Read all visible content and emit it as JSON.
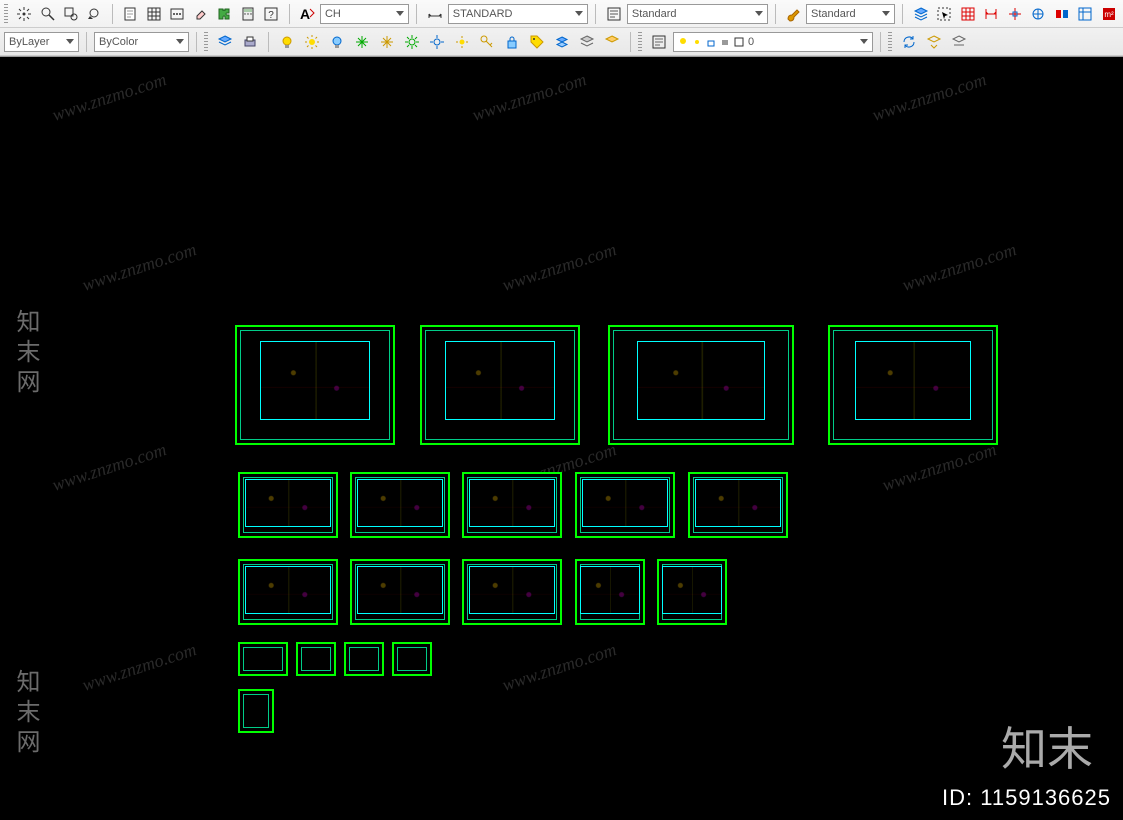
{
  "toolbar": {
    "font_style": "CH",
    "text_style": "STANDARD",
    "dim_style": "Standard",
    "table_style": "Standard",
    "line_weight": "ByLayer",
    "color_value": "ByColor",
    "layer_state": "0",
    "lock_indicator": "0"
  },
  "watermark_text": "www.znzmo.com",
  "watermark_brand": "知末",
  "side_brand": "知末网",
  "id_label": "ID: 1159136625",
  "sheets_row1": [
    1,
    2,
    3,
    4
  ],
  "sheets_row2": [
    1,
    2,
    3,
    4,
    5
  ],
  "sheets_row3": [
    1,
    2,
    3,
    4,
    5
  ],
  "sheets_row4": [
    1,
    2,
    3,
    4
  ],
  "sheets_row5": [
    1
  ]
}
